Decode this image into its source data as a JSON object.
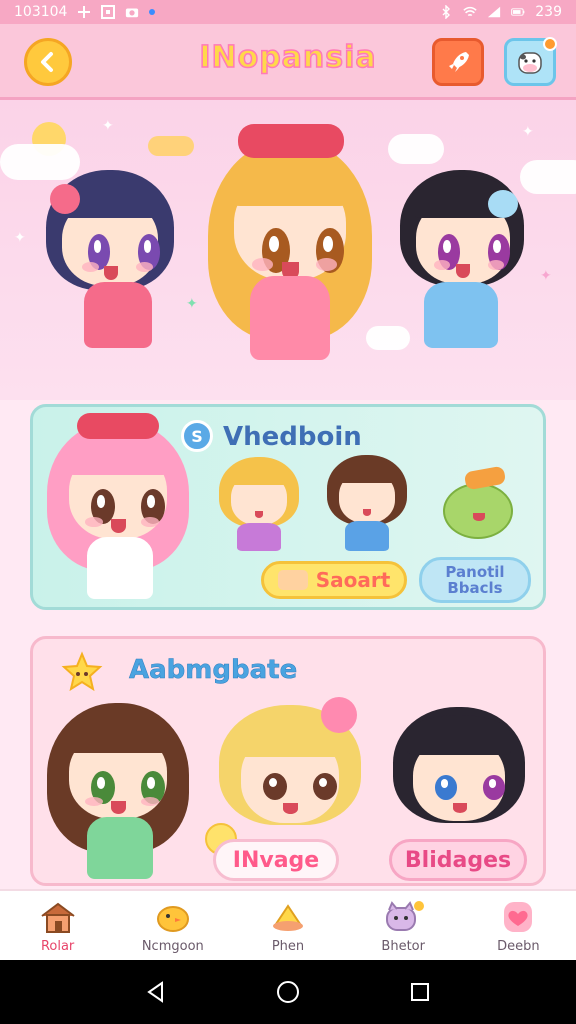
{
  "status_bar": {
    "time": "103104",
    "battery": "239",
    "icons": [
      "plus-icon",
      "screen-record-icon",
      "camera-icon",
      "bluetooth-icon",
      "wifi-icon",
      "signal-icon",
      "battery-icon"
    ]
  },
  "header": {
    "title": "INopansia",
    "back_icon": "back-arrow-icon",
    "rocket_icon": "rocket-icon",
    "profile_icon": "cow-avatar-icon"
  },
  "card1": {
    "badge": "S",
    "title": "Vhedboin",
    "search_label": "Saoart",
    "beads_line1": "Panotil",
    "beads_line2": "Bbacls"
  },
  "card2": {
    "title": "Aabmgbate",
    "image_label": "INvage",
    "badges_label": "Blidages"
  },
  "bottom_nav": {
    "items": [
      {
        "label": "Rolar",
        "icon": "house-icon",
        "active": true
      },
      {
        "label": "Ncmgoon",
        "icon": "chick-icon",
        "active": false
      },
      {
        "label": "Phen",
        "icon": "turtle-icon",
        "active": false
      },
      {
        "label": "Bhetor",
        "icon": "cat-icon",
        "active": false
      },
      {
        "label": "Deebn",
        "icon": "heart-icon",
        "active": false
      }
    ]
  },
  "colors": {
    "accent_pink": "#f7a8c4",
    "title_yellow": "#ffd84a",
    "card_teal": "#c9f2ea",
    "card_pink": "#ffe0ea"
  }
}
